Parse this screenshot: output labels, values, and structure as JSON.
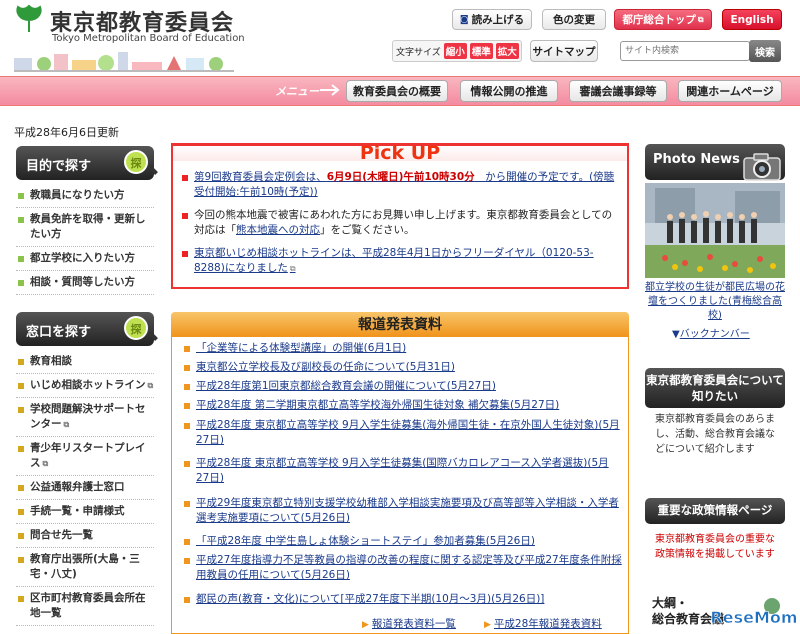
{
  "header": {
    "org_name": "東京都教育委員会",
    "org_name_en": "Tokyo Metropolitan Board of Education",
    "read_aloud": "読み上げる",
    "color_change": "色の変更",
    "gov_top": "都庁総合トップ",
    "english": "English",
    "font_size_label": "文字サイズ",
    "font_small": "縮小",
    "font_std": "標準",
    "font_large": "拡大",
    "sitemap": "サイトマップ",
    "search_placeholder": "サイト内検索",
    "search_btn": "検索"
  },
  "nav": {
    "label": "メニュー",
    "items": [
      "教育委員会の概要",
      "情報公開の推進",
      "審議会議事録等",
      "関連ホームページ"
    ]
  },
  "updated": "平成28年6月6日更新",
  "left": {
    "purpose_title": "目的で探す",
    "purpose_tab": "探",
    "purpose_items": [
      "教職員になりたい方",
      "教員免許を取得・更新したい方",
      "都立学校に入りたい方",
      "相談・質問等したい方"
    ],
    "counter_title": "窓口を探す",
    "counter_tab": "探",
    "counter_items": [
      "教育相談",
      "いじめ相談ホットライン",
      "学校問題解決サポートセンター",
      "青少年リスタートプレイス",
      "公益通報弁護士窓口",
      "手続一覧・申請様式",
      "問合せ先一覧",
      "教育庁出張所(大島・三宅・八丈)",
      "区市町村教育委員会所在地一覧"
    ]
  },
  "pickup": {
    "title": "Pick UP",
    "item1_a": "第9回教育委員会定例会は、",
    "item1_b": "6月9日(木曜日)午前10時30分",
    "item1_c": "から開催の予定です。(傍聴受付開始:午前10時(予定))",
    "item2_a": "今回の熊本地震で被害にあわれた方にお見舞い申し上げます。東京都教育委員会としての対応は「",
    "item2_link": "熊本地震への対応",
    "item2_b": "」をご覧ください。",
    "item3": "東京都いじめ相談ホットラインは、平成28年4月1日からフリーダイヤル（0120-53-8288)になりました"
  },
  "press": {
    "title": "報道発表資料",
    "items": [
      "「企業等による体験型講座」の開催(6月1日)",
      "東京都公立学校長及び副校長の任命について(5月31日)",
      "平成28年度第1回東京都総合教育会議の開催について(5月27日)",
      "平成28年度 第二学期東京都立高等学校海外帰国生徒対象 補欠募集(5月27日)",
      "平成28年度 東京都立高等学校 9月入学生徒募集(海外帰国生徒・在京外国人生徒対象)(5月27日)",
      "平成28年度 東京都立高等学校 9月入学生徒募集(国際バカロレアコース入学者選抜)(5月27日)",
      "平成29年度東京都立特別支援学校幼稚部入学相談実施要項及び高等部等入学相談・入学者選考実施要項について(5月26日)",
      "「平成28年度 中学生島しょ体験ショートステイ」参加者募集(5月26日)",
      "平成27年度指導力不足等教員の指導の改善の程度に関する認定等及び平成27年度条件附採用教員の任用について(5月26日)",
      "都民の声(教育・文化)について[平成27年度下半期(10月～3月)(5月26日)]"
    ],
    "more1": "報道発表資料一覧",
    "more2": "平成28年報道発表資料"
  },
  "right": {
    "photo_title": "Photo News",
    "photo_caption": "都立学校の生徒が都民広場の花壇をつくりました(青梅総合高校)",
    "back_number": "バックナンバー",
    "about_title": "東京都教育委員会について知りたい",
    "about_text": "東京都教育委員会のあらまし、活動、総合教育会議などについて紹介します",
    "policy_title": "重要な政策情報ページ",
    "policy_text": "東京都教育委員会の重要な政策情報を掲載しています",
    "tail_line1": "大綱・",
    "tail_line2": "総合教育会議"
  },
  "watermark": "ReseMom",
  "colors": {
    "accent_red": "#e33",
    "press_orange": "#f0951e",
    "link_blue": "#1a3a8a",
    "nav_pink": "#f48aa0"
  }
}
